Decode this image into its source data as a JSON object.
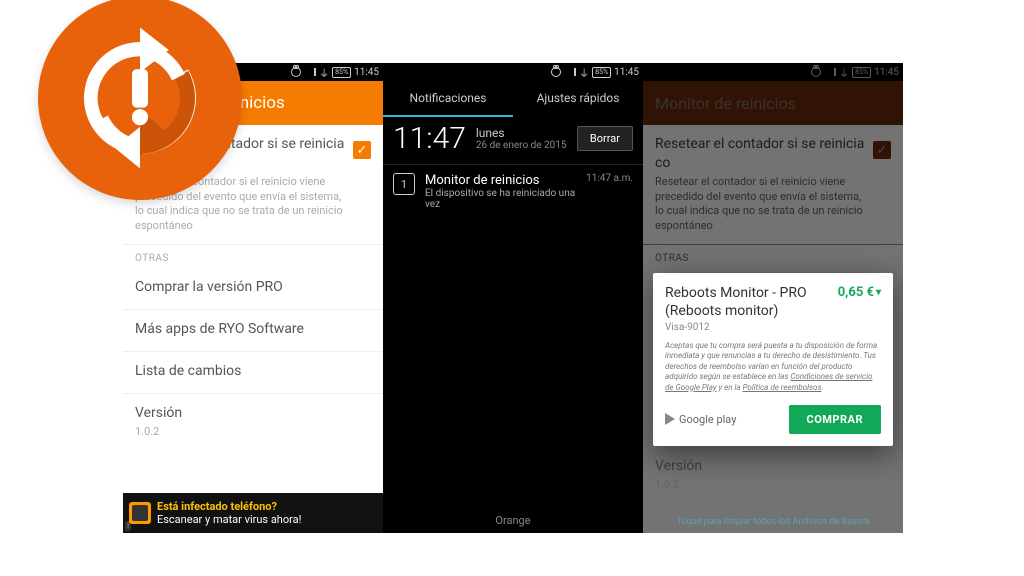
{
  "statusbar": {
    "battery": "85%",
    "time": "11:45"
  },
  "logo_name": "reboots-monitor-app-icon",
  "screen1": {
    "header": "Monitor de reinicios",
    "setting": {
      "title": "Resetear el contador si se reinicia co",
      "desc": "Resetear el contador si el reinicio viene precedido del evento que envía el sistema, lo cual indica que no se trata de un reinicio espontáneo",
      "checked": true
    },
    "section": "OTRAS",
    "items": [
      "Comprar la versión PRO",
      "Más apps de RYO Software",
      "Lista de cambios"
    ],
    "version": {
      "label": "Versión",
      "value": "1.0.2"
    },
    "ad": {
      "line1": "Está infectado teléfono?",
      "line2": "Escanear y matar virus ahora!"
    }
  },
  "screen2": {
    "tabs": [
      "Notificaciones",
      "Ajustes rápidos"
    ],
    "active_tab": 0,
    "clock": "11:47",
    "day": "lunes",
    "date": "26 de enero de 2015",
    "clear": "Borrar",
    "notification": {
      "title": "Monitor de reinicios",
      "body": "El dispositivo se ha reiniciado una vez",
      "time": "11:47 a.m.",
      "badge": "1"
    },
    "carrier": "Orange"
  },
  "screen3": {
    "header": "Monitor de reinicios",
    "hint": "Toque para limpiar todos los Archivos de Basura",
    "dialog": {
      "title": "Reboots Monitor - PRO\n(Reboots monitor)",
      "card": "Visa-9012",
      "price": "0,65 €",
      "terms_pre": "Aceptas que tu compra será puesta a tu disposición de forma inmediata y que renuncias a tu derecho de desistimiento. Tus derechos de reembolso varían en función del producto adquirido según se establece en las ",
      "terms_link1": "Condiciones de servicio de Google Play",
      "terms_mid": " y en la ",
      "terms_link2": "Política de reembolsos",
      "gplay": "Google play",
      "buy": "COMPRAR"
    }
  }
}
